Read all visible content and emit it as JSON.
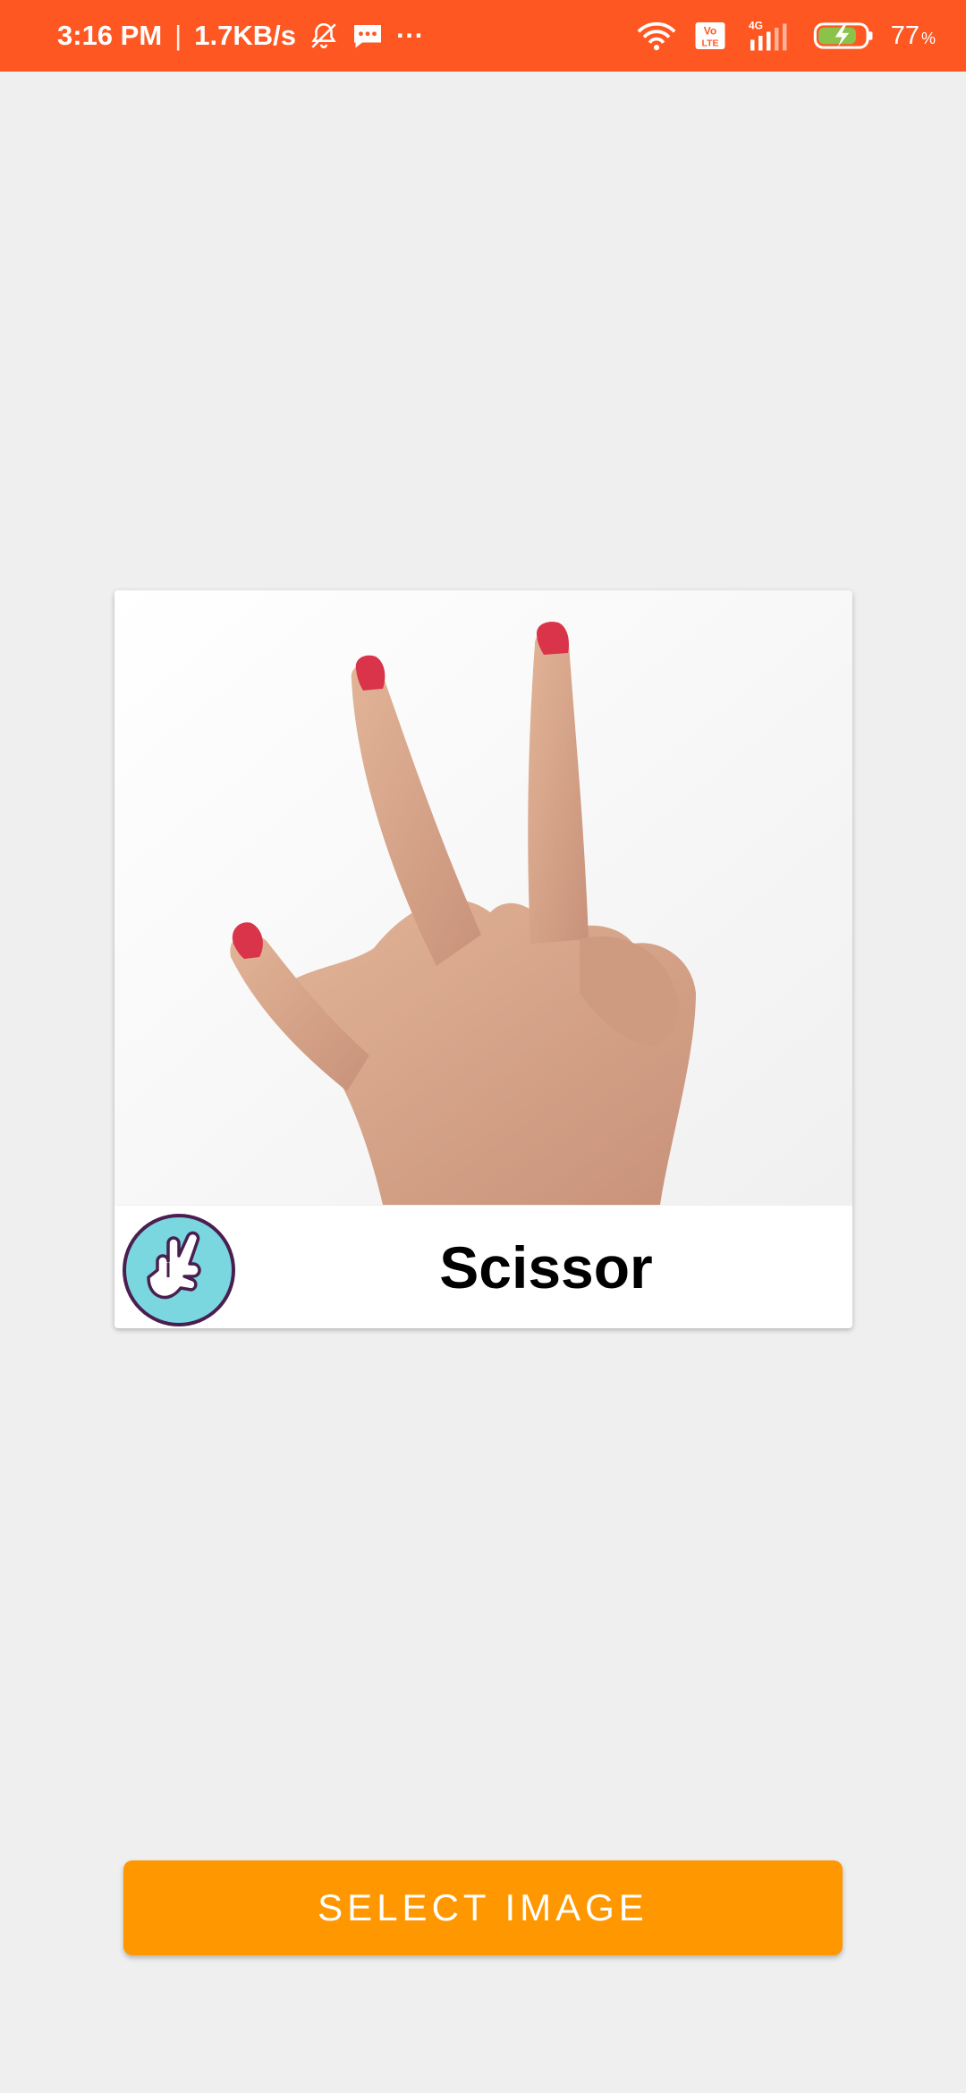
{
  "status_bar": {
    "time": "3:16 PM",
    "separator": "|",
    "net_speed": "1.7KB/s",
    "more": "···",
    "battery_percent": "77",
    "battery_unit": "%",
    "network_type": "4G",
    "volte_label": "Vo LTE",
    "icons": [
      "mute-bell-icon",
      "message-icon",
      "wifi-icon",
      "volte-icon",
      "signal-icon",
      "battery-charging-icon"
    ]
  },
  "result_card": {
    "label": "Scissor",
    "icon": "scissor-hand-icon",
    "image": "hand-gesture-photo"
  },
  "actions": {
    "select_image_label": "SELECT IMAGE"
  },
  "colors": {
    "status_bar": "#ff5722",
    "button": "#ff9800",
    "background": "#efefef",
    "icon_circle": "#7ad6df",
    "icon_ring": "#4a1f4f",
    "nail": "#d9344a",
    "skin": "#d9a88a"
  }
}
